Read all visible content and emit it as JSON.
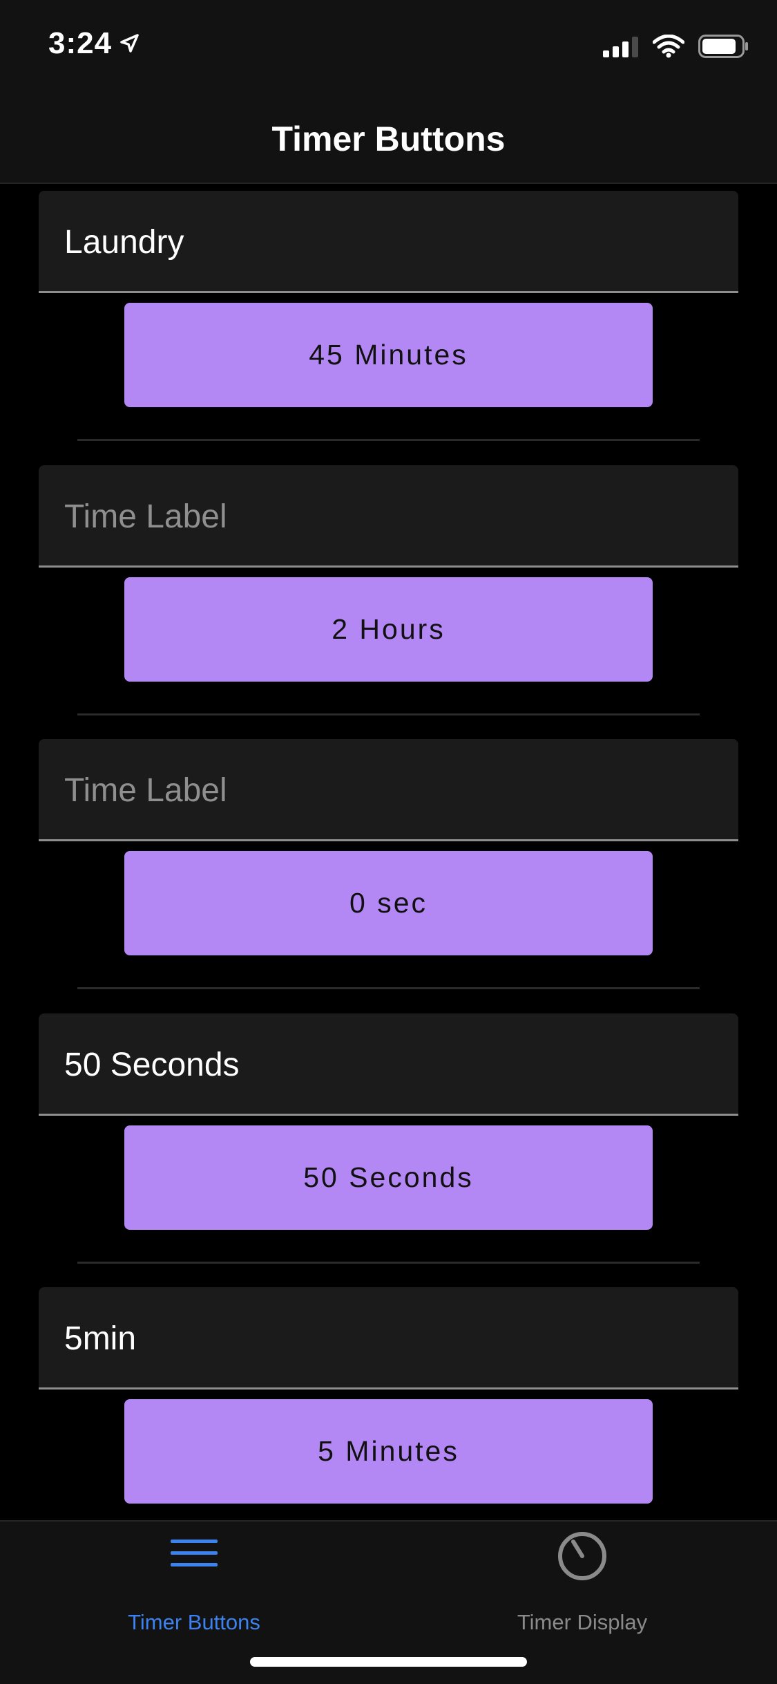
{
  "status_bar": {
    "time": "3:24",
    "icons": [
      "location-arrow-icon",
      "cellular-signal-icon",
      "wifi-icon",
      "battery-icon"
    ]
  },
  "header": {
    "title": "Timer Buttons"
  },
  "timers": [
    {
      "label_value": "Laundry",
      "label_placeholder": "Time Label",
      "button_label": "45 Minutes"
    },
    {
      "label_value": "",
      "label_placeholder": "Time Label",
      "button_label": "2 Hours"
    },
    {
      "label_value": "",
      "label_placeholder": "Time Label",
      "button_label": "0 sec"
    },
    {
      "label_value": "50 Seconds",
      "label_placeholder": "Time Label",
      "button_label": "50 Seconds"
    },
    {
      "label_value": "5min",
      "label_placeholder": "Time Label",
      "button_label": "5 Minutes"
    }
  ],
  "tabs": [
    {
      "label": "Timer Buttons",
      "icon": "menu-lines-icon",
      "active": true
    },
    {
      "label": "Timer Display",
      "icon": "timer-dial-icon",
      "active": false
    }
  ],
  "colors": {
    "background": "#000000",
    "bar_background": "#121212",
    "field_background": "#1b1b1b",
    "button": "#b388f5",
    "active_tab": "#3c82f0",
    "inactive_tab": "#8a8a8a",
    "placeholder": "#8f8f8f"
  }
}
